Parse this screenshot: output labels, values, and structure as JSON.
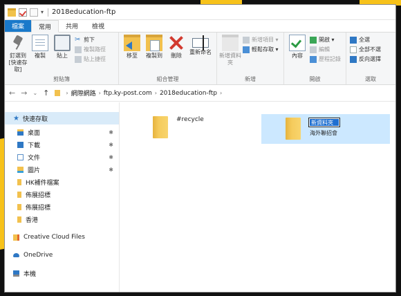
{
  "window": {
    "title": "2018education-ftp"
  },
  "tabs": [
    {
      "label": "檔案"
    },
    {
      "label": "常用"
    },
    {
      "label": "共用"
    },
    {
      "label": "檢視"
    }
  ],
  "ribbon": {
    "clipboard": {
      "pin_label": "釘選到 [快速存取]",
      "copy_label": "複製",
      "paste_label": "貼上",
      "cut_label": "剪下",
      "copy_path_label": "複製路徑",
      "paste_shortcut_label": "貼上捷徑",
      "group_label": "剪貼簿"
    },
    "organize": {
      "move_to_label": "移至",
      "copy_to_label": "複製到",
      "delete_label": "刪除",
      "rename_label": "重新命名",
      "group_label": "組合管理"
    },
    "new": {
      "new_folder_label": "新增資料夾",
      "new_item_label": "新增項目 ▾",
      "easy_access_label": "輕鬆存取 ▾",
      "group_label": "新增"
    },
    "open": {
      "properties_label": "內容",
      "open_label": "開啟 ▾",
      "edit_label": "編輯",
      "history_label": "歷程記錄",
      "group_label": "開啟"
    },
    "select": {
      "select_all_label": "全選",
      "select_none_label": "全部不選",
      "invert_label": "反向選擇",
      "group_label": "選取"
    }
  },
  "addressbar": {
    "nav_back": "←",
    "nav_forward": "→",
    "nav_recent": "⌄",
    "nav_up": "↑",
    "crumbs": [
      "網際網路",
      "ftp.ky-post.com",
      "2018education-ftp"
    ]
  },
  "sidebar": {
    "quick_access": "快速存取",
    "items": [
      {
        "label": "桌面",
        "pinned": true
      },
      {
        "label": "下載",
        "pinned": true
      },
      {
        "label": "文件",
        "pinned": true
      },
      {
        "label": "圖片",
        "pinned": true
      },
      {
        "label": "HK補件檔案",
        "pinned": false
      },
      {
        "label": "佈展招標",
        "pinned": false
      },
      {
        "label": "佈展招標",
        "pinned": false
      },
      {
        "label": "香港",
        "pinned": false
      }
    ],
    "creative_cloud": "Creative Cloud Files",
    "onedrive": "OneDrive",
    "this_pc": "本機"
  },
  "files": [
    {
      "name": "#recycle"
    },
    {
      "rename_value": "新資料夾",
      "sublabel": "海外聯招會"
    }
  ],
  "colors": {
    "accent": "#1979ca",
    "selection": "#cce8ff",
    "folder": "#f2c14e",
    "delete": "#d23a2f",
    "background_accent": "#f7c21a"
  }
}
